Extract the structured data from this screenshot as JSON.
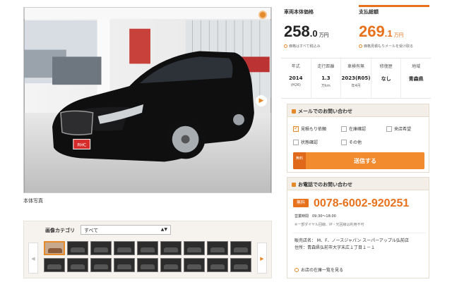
{
  "photo": {
    "caption": "本体写真",
    "brand_plate": "RHC"
  },
  "gallery": {
    "category_label": "画像カテゴリ",
    "category_value": "すべて",
    "thumb_count": 18,
    "selected_index": 0
  },
  "price": {
    "base_label": "車両本体価格",
    "base_int": "258",
    "base_dec": ".0",
    "base_unit": "万円",
    "base_note": "価格はすべて税込み",
    "total_label": "支払総額",
    "total_int": "269",
    "total_dec": ".1",
    "total_unit": "万円",
    "total_note": "価格見積もりメールを受け取る"
  },
  "specs": [
    {
      "head": "年式",
      "value": "2014",
      "sub": "(H26)"
    },
    {
      "head": "走行距離",
      "value": "1.3",
      "sub": "万km"
    },
    {
      "head": "車検有無",
      "value": "2023(R05)",
      "sub": "年4月"
    },
    {
      "head": "修復歴",
      "value": "なし",
      "sub": ""
    },
    {
      "head": "地域",
      "value": "青森県",
      "sub": ""
    }
  ],
  "mail": {
    "title": "メールでのお問い合わせ",
    "options": [
      {
        "label": "見積もり依頼",
        "checked": true
      },
      {
        "label": "在庫確認",
        "checked": false
      },
      {
        "label": "来店希望",
        "checked": false
      },
      {
        "label": "状態確認",
        "checked": false
      },
      {
        "label": "その他",
        "checked": false
      }
    ],
    "free_badge": "無料",
    "send_label": "送信する"
  },
  "tel": {
    "title": "お電話でのお問い合わせ",
    "free_badge": "無料",
    "number": "0078-6002-920251",
    "hours": "営業時間　09:30～18:00",
    "note": "※一部ダイヤル回線、IP・光回線は利用不可",
    "shop_name": "販売店名： M、F、ノースジャパン スーパーアップル弘前店",
    "shop_address": "住所：青森県弘前市大字末広１丁目１－１",
    "stock_link": "お店の在庫一覧を見る"
  }
}
